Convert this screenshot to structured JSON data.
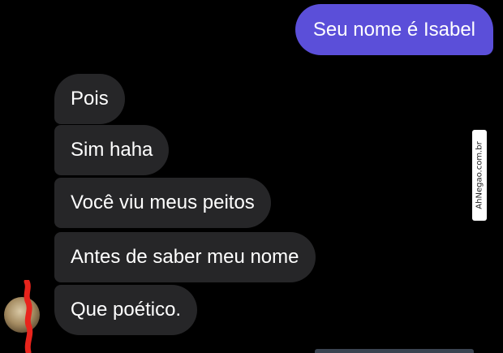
{
  "chat": {
    "outgoing": [
      {
        "text": "Seu nome é Isabel"
      }
    ],
    "incoming": [
      {
        "text": "Pois"
      },
      {
        "text": "Sim haha"
      },
      {
        "text": "Você viu meus peitos"
      },
      {
        "text": "Antes de saber meu nome"
      },
      {
        "text": "Que poético."
      }
    ]
  },
  "watermark": {
    "text": "AhNegao.com.br"
  },
  "colors": {
    "background": "#000000",
    "outgoing_bubble": "#5b4fd9",
    "incoming_bubble": "#262628",
    "text": "#ffffff",
    "redaction": "#e8241c"
  }
}
